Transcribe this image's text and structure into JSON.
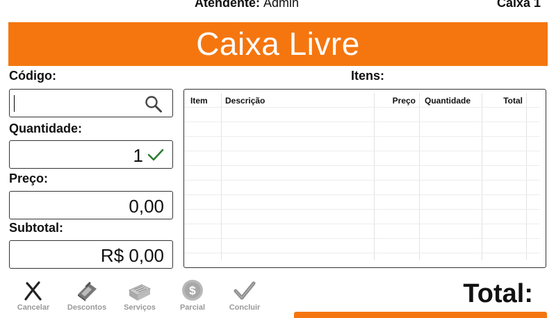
{
  "header": {
    "attendant_label": "Atendente:",
    "attendant_name": "Admin",
    "register_label": "Caixa 1"
  },
  "banner": {
    "status": "Caixa Livre"
  },
  "form": {
    "code_label": "Código:",
    "code_value": "",
    "quantity_label": "Quantidade:",
    "quantity_value": "1",
    "price_label": "Preço:",
    "price_value": "0,00",
    "subtotal_label": "Subtotal:",
    "subtotal_value": "R$ 0,00"
  },
  "items": {
    "label": "Itens:",
    "columns": [
      "Item",
      "Descrição",
      "Preço",
      "Quantidade",
      "Total"
    ],
    "rows": []
  },
  "toolbar": {
    "cancel": "Cancelar",
    "discounts": "Descontos",
    "services": "Serviços",
    "partial": "Parcial",
    "finish": "Concluir"
  },
  "total": {
    "label": "Total:"
  },
  "colors": {
    "accent": "#f5760f",
    "confirm": "#2e7d32"
  }
}
